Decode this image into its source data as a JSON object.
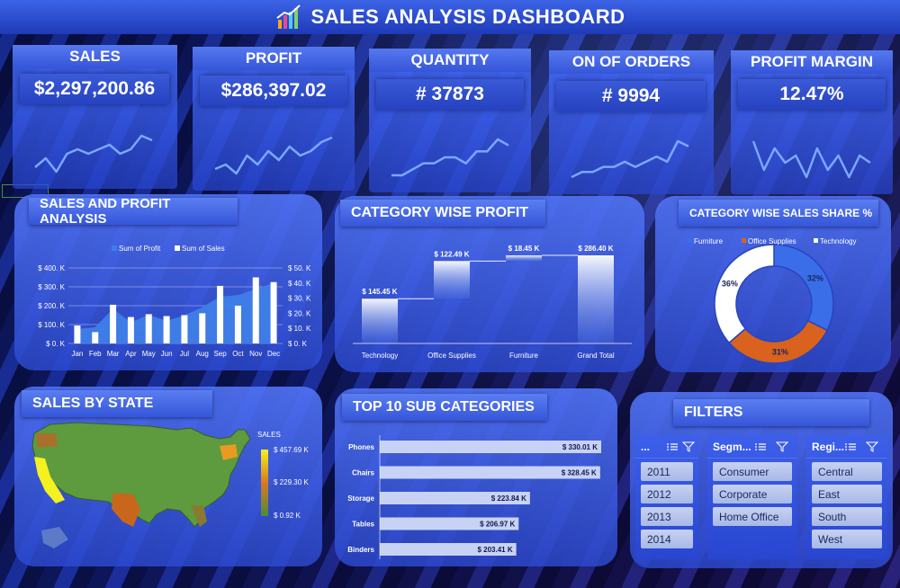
{
  "header": {
    "title": "SALES ANALYSIS DASHBOARD",
    "logo_icon": "bar-chart-icon"
  },
  "kpis": [
    {
      "label": "SALES",
      "value": "$2,297,200.86",
      "trend": [
        3,
        5,
        2,
        6,
        7,
        6,
        7,
        8,
        6,
        7,
        10,
        9
      ]
    },
    {
      "label": "PROFIT",
      "value": "$286,397.02",
      "trend": [
        2,
        3,
        1,
        5,
        3,
        6,
        4,
        7,
        5,
        6,
        8,
        9
      ]
    },
    {
      "label": "QUANTITY",
      "value": "# 37873",
      "trend": [
        3,
        3,
        4,
        5,
        5,
        6,
        6,
        5,
        7,
        7,
        9,
        8
      ]
    },
    {
      "label": "ON OF ORDERS",
      "value": "# 9994",
      "trend": [
        2,
        3,
        3,
        4,
        4,
        5,
        4,
        5,
        6,
        5,
        9,
        8
      ]
    },
    {
      "label": "PROFIT MARGIN",
      "value": "12.47%",
      "trend": [
        8,
        4,
        7,
        5,
        6,
        3,
        7,
        4,
        6,
        3,
        6,
        5
      ]
    }
  ],
  "panels": {
    "sales_profit": "SALES AND PROFIT ANALYSIS",
    "category_profit": "CATEGORY WISE PROFIT",
    "category_share": "CATEGORY WISE SALES SHARE %",
    "sales_state": "SALES BY STATE",
    "top10": "TOP 10 SUB CATEGORIES",
    "filters": "FILTERS"
  },
  "chart_data": [
    {
      "type": "bar",
      "legend": [
        "Sum of Profit",
        "Sum of Sales"
      ],
      "categories": [
        "Jan",
        "Feb",
        "Mar",
        "Apr",
        "May",
        "Jun",
        "Jul",
        "Aug",
        "Sep",
        "Oct",
        "Nov",
        "Dec"
      ],
      "series": [
        {
          "name": "Sum of Profit",
          "type": "area",
          "axis": "right",
          "values": [
            9.5,
            10.8,
            23,
            14,
            19,
            15,
            18.5,
            24,
            31,
            32,
            36,
            40
          ]
        },
        {
          "name": "Sum of Sales",
          "type": "bar",
          "axis": "left",
          "values": [
            95,
            60,
            205,
            140,
            155,
            145,
            150,
            160,
            305,
            200,
            350,
            325
          ]
        }
      ],
      "left_ticks": [
        "$ 0. K",
        "$ 100. K",
        "$ 200. K",
        "$ 300. K",
        "$ 400. K"
      ],
      "right_ticks": [
        "$ 0. K",
        "$ 10. K",
        "$ 20. K",
        "$ 30. K",
        "$ 40. K",
        "$ 50. K"
      ],
      "ylim_left": [
        0,
        400
      ],
      "ylim_right": [
        0,
        50
      ]
    },
    {
      "type": "bar",
      "subtype": "waterfall",
      "categories": [
        "Technology",
        "Office Supplies",
        "Furniture",
        "Grand Total"
      ],
      "values": [
        145.45,
        122.49,
        18.45,
        286.4
      ],
      "labels": [
        "$ 145.45 K",
        "$ 122.49 K",
        "$ 18.45 K",
        "$ 286.40 K"
      ]
    },
    {
      "type": "pie",
      "donut": true,
      "categories": [
        "Furniture",
        "Office Supplies",
        "Technology"
      ],
      "values": [
        32,
        31,
        36
      ],
      "labels": [
        "32%",
        "31%",
        "36%"
      ],
      "colors": [
        "#3a6ee8",
        "#d8621e",
        "#ffffff"
      ]
    },
    {
      "type": "bar",
      "orientation": "horizontal",
      "categories": [
        "Phones",
        "Chairs",
        "Storage",
        "Tables",
        "Binders"
      ],
      "values": [
        330.01,
        328.45,
        223.84,
        206.97,
        203.41
      ],
      "labels": [
        "$ 330.01 K",
        "$ 328.45 K",
        "$ 223.84 K",
        "$ 206.97 K",
        "$ 203.41 K"
      ]
    },
    {
      "type": "heatmap",
      "subtype": "map",
      "legend_title": "SALES",
      "legend_ticks": [
        "$ 457.69 K",
        "$ 229.30 K",
        "$ 0.92 K"
      ]
    }
  ],
  "filters": {
    "year": {
      "label": "...",
      "items": [
        "2011",
        "2012",
        "2013",
        "2014"
      ]
    },
    "segment": {
      "label": "Segm...",
      "items": [
        "Consumer",
        "Corporate",
        "Home Office"
      ]
    },
    "region": {
      "label": "Regi...",
      "items": [
        "Central",
        "East",
        "South",
        "West"
      ]
    }
  }
}
